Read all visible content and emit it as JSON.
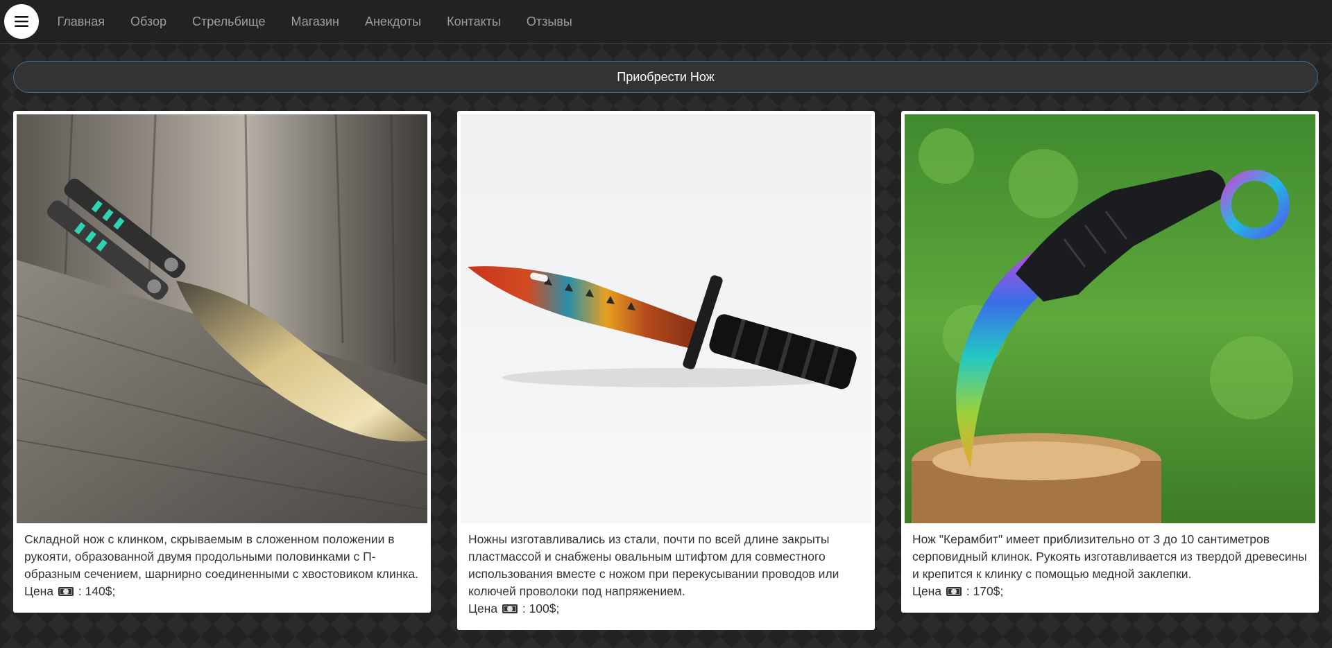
{
  "nav": {
    "menu_icon": "hamburger-menu-icon",
    "items": [
      {
        "label": "Главная"
      },
      {
        "label": "Обзор"
      },
      {
        "label": "Стрельбище"
      },
      {
        "label": "Магазин"
      },
      {
        "label": "Анекдоты"
      },
      {
        "label": "Контакты"
      },
      {
        "label": "Отзывы"
      }
    ]
  },
  "buy_button": {
    "label": "Приобрести Нож"
  },
  "products": [
    {
      "image_name": "butterfly-knife-image",
      "description": "Складной нож с клинком, скрываемым в сложенном положении в рукояти, образованной двумя продольными половинками с П-образным сечением, шарнирно соединенными с хвостовиком клинка.",
      "price_label": "Цена",
      "price_value": ": 140$;"
    },
    {
      "image_name": "bayonet-knife-image",
      "description": "Ножны изготавливались из стали, почти по всей длине закрыты пластмассой и снабжены овальным штифтом для совместного использования вместе с ножом при перекусывании проводов или колючей проволоки под напряжением.",
      "price_label": "Цена",
      "price_value": ": 100$;"
    },
    {
      "image_name": "karambit-knife-image",
      "description": "Нож \"Керамбит\" имеет приблизительно от 3 до 10 сантиметров серповидный клинок. Рукоять изготавливается из твердой древесины и крепится к клинку с помощью медной заклепки.",
      "price_label": "Цена",
      "price_value": ": 170$;"
    }
  ],
  "colors": {
    "navbar": "#222222",
    "nav_link": "#9d9d9d",
    "buy_border": "#3a6a8f"
  }
}
